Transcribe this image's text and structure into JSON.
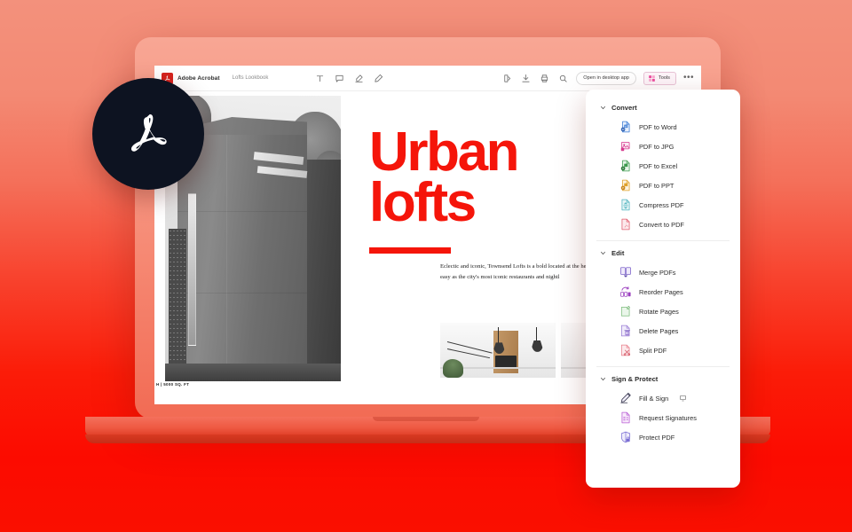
{
  "theme": {
    "bg_top": "#F3917C",
    "bg_bottom": "#FA0F00",
    "accent_red": "#F5150A",
    "badge_bg": "#0D1321",
    "laptop_red": "#EF5A43"
  },
  "toolbar": {
    "logo_icon": "adobe-acrobat-logo-icon",
    "app_name": "Adobe Acrobat",
    "document_name": "Lofts Lookbook",
    "tools": [
      {
        "name": "add-text-icon",
        "glyph": "T"
      },
      {
        "name": "add-comment-icon",
        "glyph": "comment"
      },
      {
        "name": "highlight-icon",
        "glyph": "highlighter"
      },
      {
        "name": "draw-icon",
        "glyph": "pen"
      }
    ],
    "actions": [
      {
        "name": "share-icon",
        "glyph": "share"
      },
      {
        "name": "download-icon",
        "glyph": "download"
      },
      {
        "name": "print-icon",
        "glyph": "print"
      },
      {
        "name": "search-icon",
        "glyph": "search"
      }
    ],
    "open_desktop_label": "Open in desktop app",
    "tools_button_label": "Tools",
    "overflow_label": "•••"
  },
  "document": {
    "headline": "Urban\nlofts",
    "body_text": "Eclectic and iconic, Townsend Lofts is a bold located at the heart of the city, you have easy as the city's most iconic restaurants and nightl",
    "photo_caption": "H | 5000 SQ. FT",
    "photo_alt": "modern-architecture-photo",
    "interior_alt_1": "interior-kitchen-photo",
    "interior_alt_2": "interior-appliance-photo"
  },
  "badge": {
    "icon": "adobe-acrobat-badge-icon"
  },
  "tools_panel": {
    "groups": [
      {
        "title": "Convert",
        "chevron": "chevron-down-icon",
        "items": [
          {
            "label": "PDF to Word",
            "icon": "pdf-to-word-icon",
            "color": "#3A7BD5"
          },
          {
            "label": "PDF to JPG",
            "icon": "pdf-to-jpg-icon",
            "color": "#D63A8E"
          },
          {
            "label": "PDF to Excel",
            "icon": "pdf-to-excel-icon",
            "color": "#3E9B4F"
          },
          {
            "label": "PDF to PPT",
            "icon": "pdf-to-ppt-icon",
            "color": "#E0A22A"
          },
          {
            "label": "Compress PDF",
            "icon": "compress-pdf-icon",
            "color": "#4FB3BF"
          },
          {
            "label": "Convert to PDF",
            "icon": "convert-to-pdf-icon",
            "color": "#E05A6B"
          }
        ]
      },
      {
        "title": "Edit",
        "chevron": "chevron-down-icon",
        "items": [
          {
            "label": "Merge PDFs",
            "icon": "merge-pdfs-icon",
            "color": "#7B61C9"
          },
          {
            "label": "Reorder Pages",
            "icon": "reorder-pages-icon",
            "color": "#9B3FBF"
          },
          {
            "label": "Rotate Pages",
            "icon": "rotate-pages-icon",
            "color": "#8FC98F"
          },
          {
            "label": "Delete Pages",
            "icon": "delete-pages-icon",
            "color": "#9B7FD4"
          },
          {
            "label": "Split PDF",
            "icon": "split-pdf-icon",
            "color": "#E8808C"
          }
        ]
      },
      {
        "title": "Sign & Protect",
        "chevron": "chevron-down-icon",
        "items": [
          {
            "label": "Fill & Sign",
            "icon": "fill-and-sign-icon",
            "color": "#3A3A52",
            "badge": "desktop-only-icon"
          },
          {
            "label": "Request Signatures",
            "icon": "request-signatures-icon",
            "color": "#B75BD4"
          },
          {
            "label": "Protect PDF",
            "icon": "protect-pdf-icon",
            "color": "#7B6FD4"
          }
        ]
      }
    ]
  }
}
